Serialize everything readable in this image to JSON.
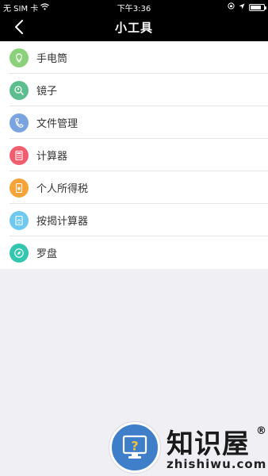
{
  "status": {
    "carrier": "无 SIM 卡",
    "time": "下午3:36",
    "battery_level": 0.8
  },
  "nav": {
    "title": "小工具"
  },
  "tools": [
    {
      "label": "手电筒",
      "icon": "flashlight-icon",
      "color": "#8bd17a"
    },
    {
      "label": "镜子",
      "icon": "mirror-icon",
      "color": "#5cbd8e"
    },
    {
      "label": "文件管理",
      "icon": "file-manager-icon",
      "color": "#7aa4e0"
    },
    {
      "label": "计算器",
      "icon": "calculator-icon",
      "color": "#ef5d6e"
    },
    {
      "label": "个人所得税",
      "icon": "tax-icon",
      "color": "#f6a43a"
    },
    {
      "label": "按揭计算器",
      "icon": "mortgage-calculator-icon",
      "color": "#6fc8ef"
    },
    {
      "label": "罗盘",
      "icon": "compass-icon",
      "color": "#35c6b0"
    }
  ],
  "watermark": {
    "brand": "知识屋",
    "reg": "®",
    "url": "zhishiwu.com"
  }
}
